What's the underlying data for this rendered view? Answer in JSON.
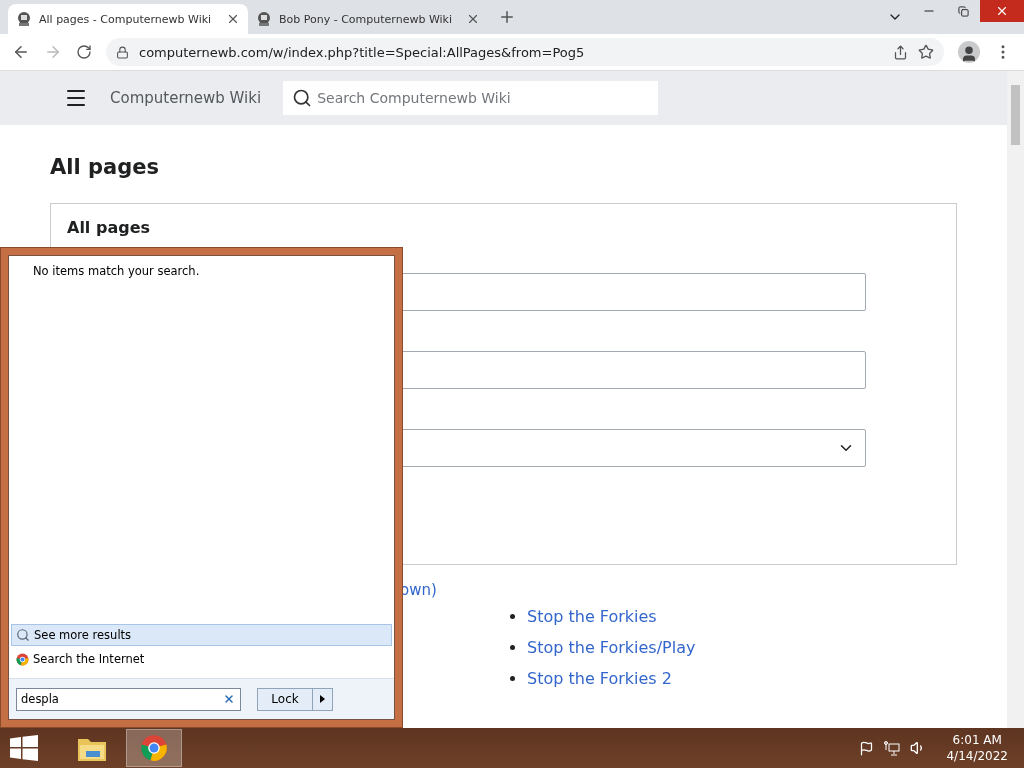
{
  "browser": {
    "tabs": [
      {
        "title": "All pages - Computernewb Wiki",
        "selected": true
      },
      {
        "title": "Bob Pony - Computernewb Wiki",
        "selected": false
      }
    ],
    "url": "computernewb.com/w/index.php?title=Special:AllPages&from=Pog5"
  },
  "wiki": {
    "site_name": "Computernewb Wiki",
    "search": {
      "placeholder": "Search Computernewb Wiki"
    },
    "heading": "All pages",
    "form_title": "All pages",
    "nav_link": "own)",
    "pages": [
      "Stop the Forkies",
      "Stop the Forkies/Play",
      "Stop the Forkies 2"
    ]
  },
  "start_menu": {
    "message": "No items match your search.",
    "results": [
      {
        "label": "See more results",
        "kind": "more",
        "selected": true
      },
      {
        "label": "Search the Internet",
        "kind": "internet",
        "selected": false
      }
    ],
    "search_value": "despla",
    "power_button": "Lock"
  },
  "taskbar": {
    "apps": [
      {
        "kind": "explorer",
        "selected": false
      },
      {
        "kind": "chrome",
        "selected": true
      }
    ],
    "time": "6:01 AM",
    "date": "4/14/2022"
  }
}
